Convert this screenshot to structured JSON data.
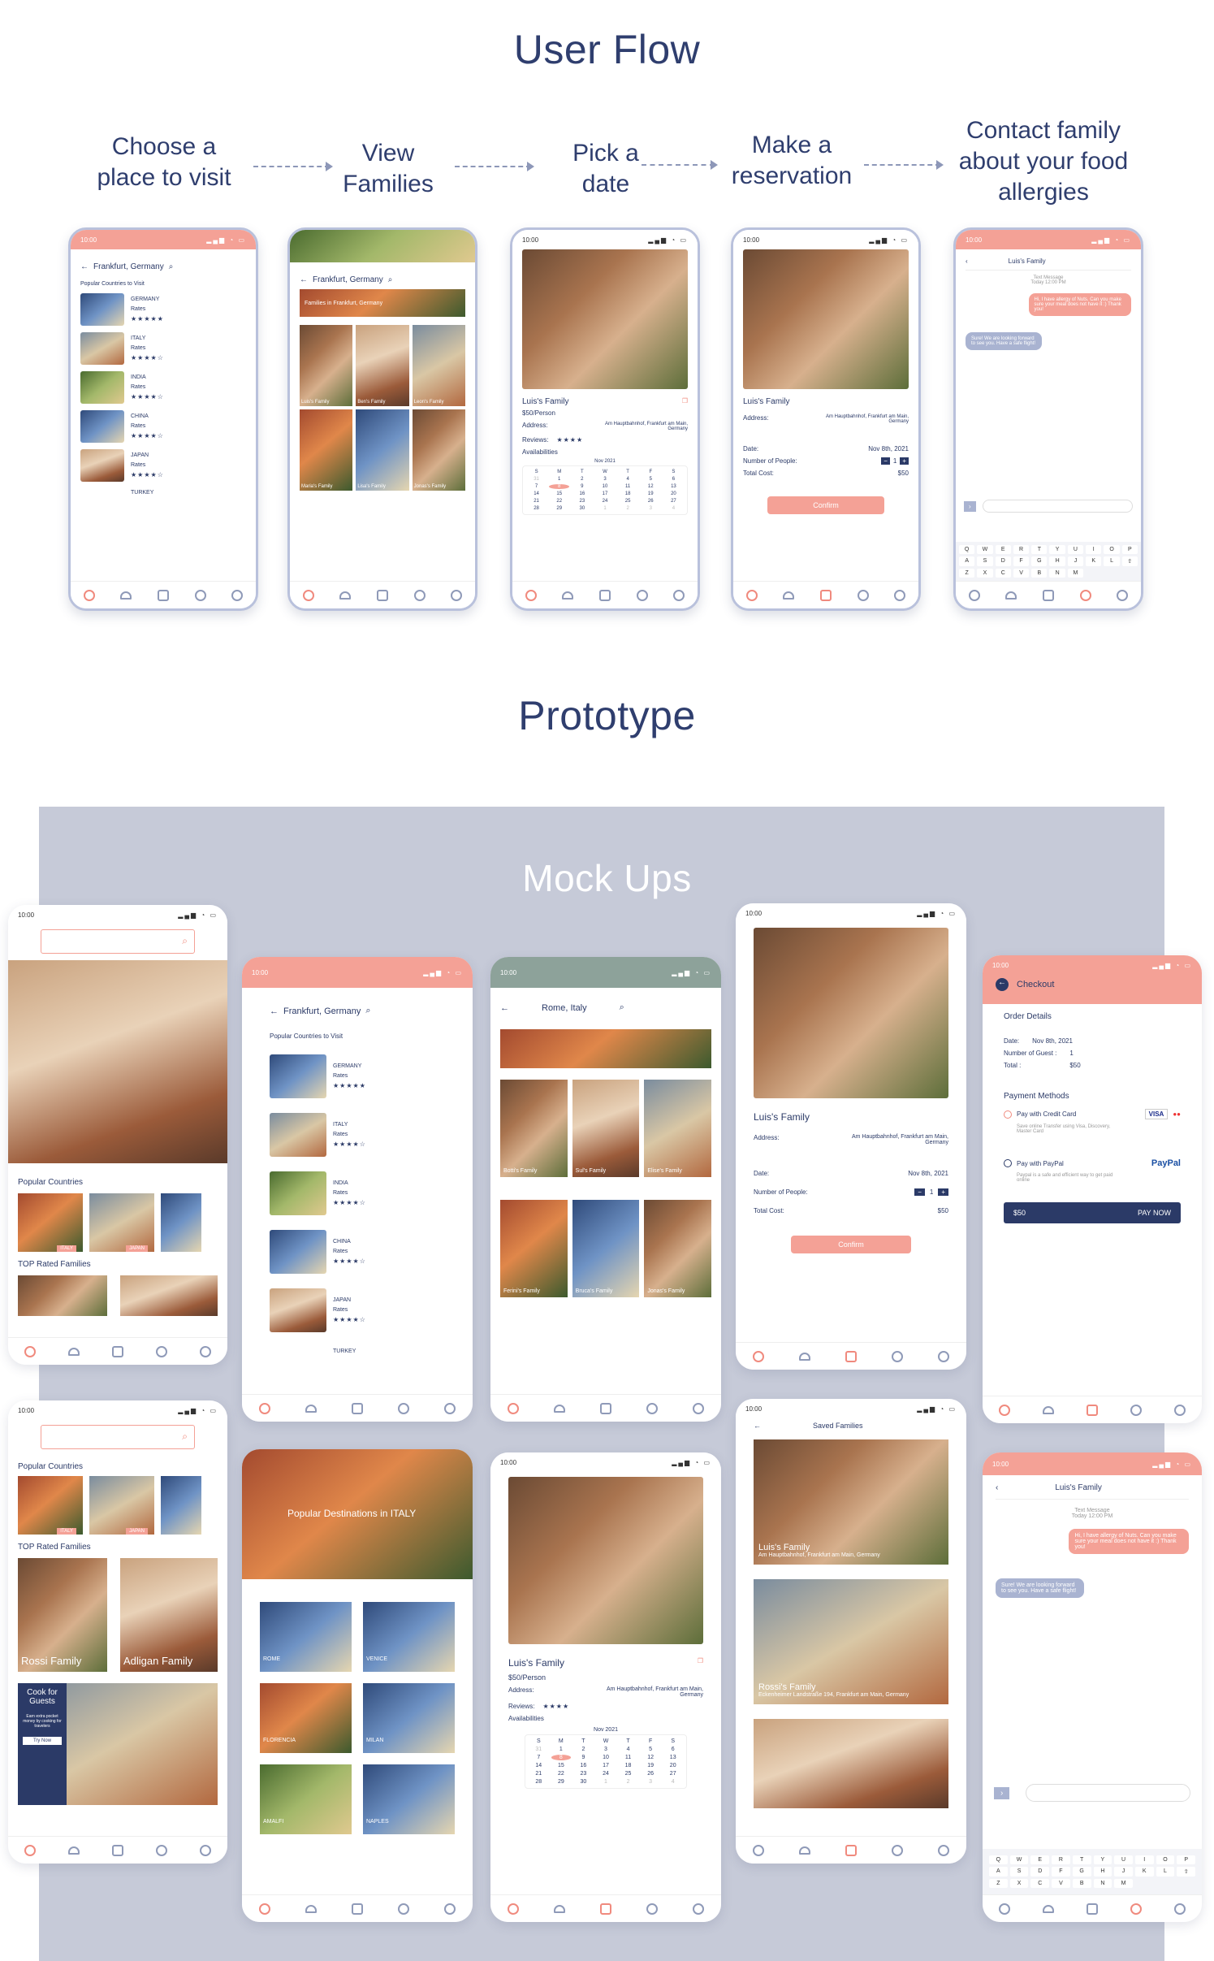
{
  "headings": {
    "user_flow": "User Flow",
    "prototype": "Prototype",
    "mock_ups": "Mock Ups"
  },
  "flow_steps": [
    "Choose a place to visit",
    "View Families",
    "Pick a date",
    "Make a reservation",
    "Contact family about your food allergies"
  ],
  "status_time": "10:00",
  "location_search": "Frankfurt, Germany",
  "rome_search": "Rome, Italy",
  "popular_countries_to_visit": "Popular Countries to Visit",
  "countries": [
    "GERMANY",
    "ITALY",
    "INDIA",
    "CHINA",
    "JAPAN",
    "TURKEY"
  ],
  "rates_label": "Rates",
  "families_banner": "Families in Frankfurt, Germany",
  "family_cards": [
    "Luis's Family",
    "Ben's Family",
    "Leon's Family",
    "Maria's Family",
    "Lisa's Family",
    "Jonas's Family"
  ],
  "rome_family_cards": [
    "Botti's Family",
    "Sul's Family",
    "Elise's Family",
    "Ferini's Family",
    "Bruca's Family",
    "Jonas's Family"
  ],
  "detail": {
    "family": "Luis's Family",
    "price": "$50/Person",
    "address_label": "Address:",
    "address": "Am Hauptbahnhof, Frankfurt am Main, Germany",
    "reviews_label": "Reviews:",
    "availabilities": "Availabilities",
    "month": "Nov 2021",
    "weekdays": [
      "S",
      "M",
      "T",
      "W",
      "T",
      "F",
      "S"
    ]
  },
  "reservation": {
    "date_label": "Date:",
    "date": "Nov 8th, 2021",
    "people_label": "Number of People:",
    "people": "1",
    "total_label": "Total Cost:",
    "total": "$50",
    "confirm": "Confirm"
  },
  "chat": {
    "title": "Luis's Family",
    "meta1": "Text Message",
    "meta2": "Today 12:00 PM",
    "msg_me": "Hi, I have allergy of Nuts. Can you make sure your meal does not have it :) Thank you!",
    "msg_them": "Sure! We are looking forward to see you. Have a safe flight!"
  },
  "keyboard": [
    "Q",
    "W",
    "E",
    "R",
    "T",
    "Y",
    "U",
    "I",
    "O",
    "P",
    "A",
    "S",
    "D",
    "F",
    "G",
    "H",
    "J",
    "K",
    "L",
    "",
    "Z",
    "X",
    "C",
    "V",
    "B",
    "N",
    "M"
  ],
  "home": {
    "popular_countries": "Popular Countries",
    "top_rated": "TOP Rated Families",
    "tags": [
      "ITALY",
      "JAPAN"
    ],
    "rossi": "Rossi Family",
    "adligan": "Adligan Family",
    "cook_title": "Cook for Guests",
    "cook_text": "Earn extra pocket money by cooking for travelers",
    "try_now": "Try Now"
  },
  "italy": {
    "banner": "Popular Destinations in ITALY",
    "cities": [
      "ROME",
      "VENICE",
      "FLORENCIA",
      "MILAN",
      "AMALFI",
      "NAPLES"
    ]
  },
  "saved": {
    "title": "Saved Families",
    "items": [
      {
        "name": "Luis's Family",
        "addr": "Am Hauptbahnhof, Frankfurt am Main, Germany"
      },
      {
        "name": "Rossi's Family",
        "addr": "Eckenheimer Landstraße 194, Frankfurt am Main, Germany"
      }
    ]
  },
  "checkout": {
    "title": "Checkout",
    "order_details": "Order Details",
    "date_label": "Date:",
    "date": "Nov 8th, 2021",
    "guests_label": "Number of Guest :",
    "guests": "1",
    "total_label": "Total :",
    "total": "$50",
    "payment_methods": "Payment Methods",
    "credit": "Pay with Credit Card",
    "credit_note": "Save online Transfer using Visa, Discovery, Master Card",
    "visa": "VISA",
    "paypal": "Pay with PayPal",
    "paypal_brand": "PayPal",
    "paypal_note": "Paypal is a safe and efficient way to get paid online",
    "amount": "$50",
    "pay_now": "PAY NOW"
  },
  "colors": {
    "accent": "#f4a196",
    "navy": "#2b3a67",
    "band": "#c6cad8"
  }
}
